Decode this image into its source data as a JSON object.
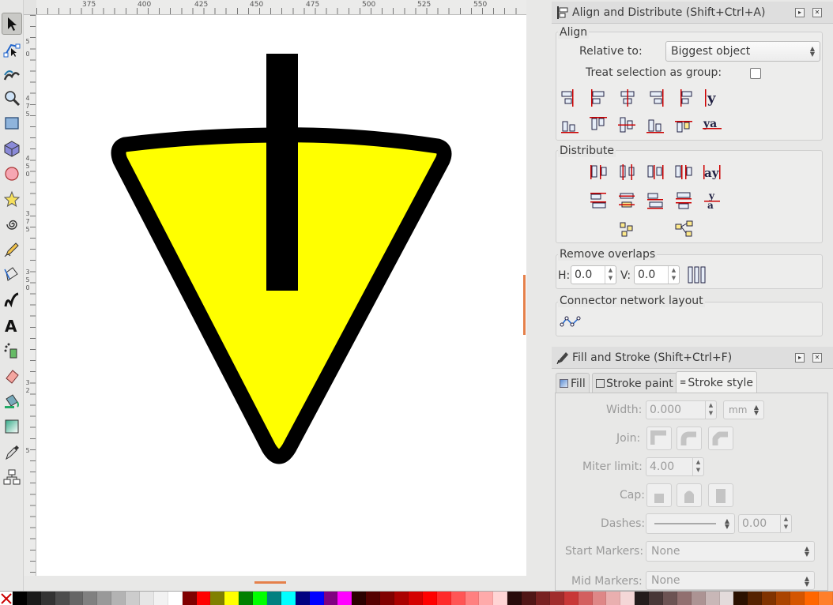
{
  "ruler": {
    "top_ticks": [
      "375",
      "400",
      "425",
      "450",
      "475",
      "500",
      "525",
      "550"
    ],
    "left_ticks": [
      "5",
      "0",
      "4",
      "7",
      "5",
      "4",
      "5",
      "0",
      "3",
      "7",
      "5",
      "3",
      "5",
      "0",
      "3",
      "2",
      "5"
    ]
  },
  "toolbox": {
    "tools": [
      "selector-icon",
      "node-icon",
      "tweak-icon",
      "zoom-icon",
      "rectangle-icon",
      "3dbox-icon",
      "ellipse-icon",
      "star-icon",
      "spiral-icon",
      "pencil-icon",
      "pen-icon",
      "calligraphy-icon",
      "text-icon",
      "spray-icon",
      "eraser-icon",
      "bucket-icon",
      "gradient-icon",
      "dropper-icon",
      "connector-icon"
    ]
  },
  "align_panel": {
    "title": "Align and Distribute (Shift+Ctrl+A)",
    "align_label": "Align",
    "relative_to_label": "Relative to:",
    "relative_to_value": "Biggest object",
    "treat_group_label": "Treat selection as group:",
    "distribute_label": "Distribute",
    "remove_overlaps_label": "Remove overlaps",
    "h_label": "H:",
    "h_value": "0.0",
    "v_label": "V:",
    "v_value": "0.0",
    "connector_label": "Connector network layout"
  },
  "fill_stroke_panel": {
    "title": "Fill and Stroke (Shift+Ctrl+F)",
    "tabs": {
      "fill": "Fill",
      "stroke_paint": "Stroke paint",
      "stroke_style": "Stroke style"
    },
    "width_label": "Width:",
    "width_value": "0.000",
    "unit": "mm",
    "join_label": "Join:",
    "miter_label": "Miter limit:",
    "miter_value": "4.00",
    "cap_label": "Cap:",
    "dashes_label": "Dashes:",
    "dash_offset": "0.00",
    "start_markers_label": "Start Markers:",
    "start_markers_value": "None",
    "mid_markers_label": "Mid Markers:",
    "mid_markers_value": "None"
  },
  "colors": {
    "accent": "#e5804a",
    "triangle_fill": "#ffff00",
    "stroke": "#000000"
  },
  "palette": [
    "#000000",
    "#1a1a1a",
    "#333333",
    "#4d4d4d",
    "#666666",
    "#808080",
    "#999999",
    "#b3b3b3",
    "#cccccc",
    "#e6e6e6",
    "#f2f2f2",
    "#ffffff",
    "#800000",
    "#ff0000",
    "#808000",
    "#ffff00",
    "#008000",
    "#00ff00",
    "#008080",
    "#00ffff",
    "#000080",
    "#0000ff",
    "#800080",
    "#ff00ff",
    "#2b0000",
    "#550000",
    "#800000",
    "#aa0000",
    "#d40000",
    "#ff0000",
    "#ff2a2a",
    "#ff5555",
    "#ff8080",
    "#ffaaaa",
    "#ffd5d5",
    "#280b0b",
    "#501616",
    "#782121",
    "#a02c2c",
    "#c83737",
    "#d35f5f",
    "#de8787",
    "#e9afaf",
    "#f4d7d7",
    "#241c1c",
    "#483737",
    "#6c5353",
    "#916f6f",
    "#ac9393",
    "#c8b7b7",
    "#e3dbdb",
    "#2b1100",
    "#552200",
    "#803300",
    "#aa4400",
    "#d45500",
    "#ff6600",
    "#ff7f2a"
  ]
}
